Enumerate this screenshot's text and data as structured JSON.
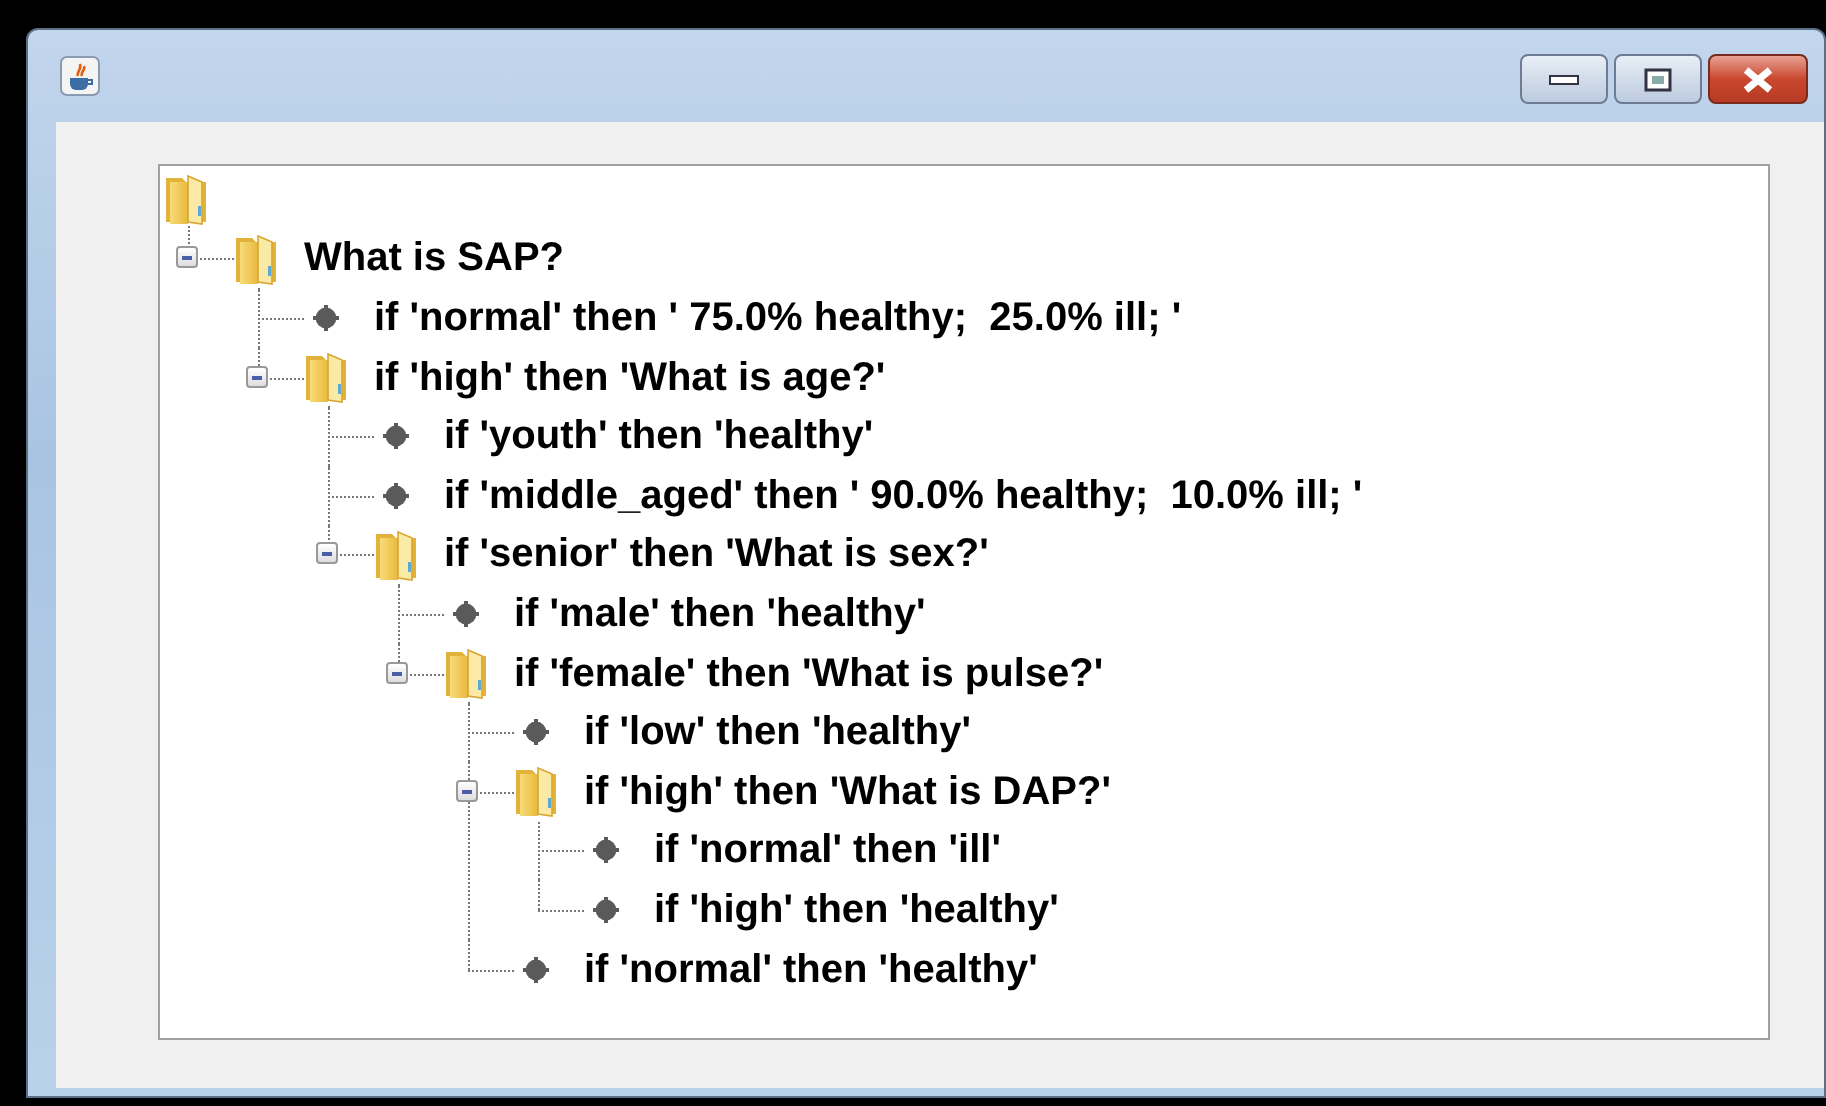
{
  "tree": {
    "kind": "folder",
    "expanded": true,
    "children": [
      {
        "kind": "folder",
        "label": "What is SAP?",
        "expanded": true,
        "children": [
          {
            "kind": "leaf",
            "label": "if 'normal' then ' 75.0% healthy;  25.0% ill; '"
          },
          {
            "kind": "folder",
            "label": "if 'high' then 'What is age?'",
            "expanded": true,
            "children": [
              {
                "kind": "leaf",
                "label": "if 'youth' then 'healthy'"
              },
              {
                "kind": "leaf",
                "label": "if 'middle_aged' then ' 90.0% healthy;  10.0% ill; '"
              },
              {
                "kind": "folder",
                "label": "if 'senior' then 'What is sex?'",
                "expanded": true,
                "children": [
                  {
                    "kind": "leaf",
                    "label": "if 'male' then 'healthy'"
                  },
                  {
                    "kind": "folder",
                    "label": "if 'female' then 'What is pulse?'",
                    "expanded": true,
                    "children": [
                      {
                        "kind": "leaf",
                        "label": "if 'low' then 'healthy'"
                      },
                      {
                        "kind": "folder",
                        "label": "if 'high' then 'What is DAP?'",
                        "expanded": true,
                        "children": [
                          {
                            "kind": "leaf",
                            "label": "if 'normal' then 'ill'"
                          },
                          {
                            "kind": "leaf",
                            "label": "if 'high' then 'healthy'"
                          }
                        ]
                      },
                      {
                        "kind": "leaf",
                        "label": "if 'normal' then 'healthy'"
                      }
                    ]
                  }
                ]
              }
            ]
          }
        ]
      }
    ]
  }
}
